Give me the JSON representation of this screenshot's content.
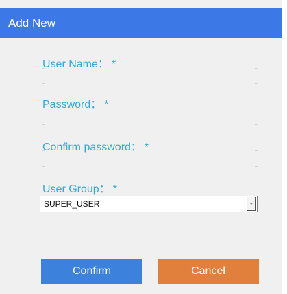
{
  "dialog": {
    "title": "Add New"
  },
  "fields": {
    "user_name": {
      "label": "User Name：",
      "required_mark": "*",
      "value": ""
    },
    "password": {
      "label": "Password：",
      "required_mark": "*",
      "value": ""
    },
    "confirm_password": {
      "label": "Confirm password：",
      "required_mark": "*",
      "value": ""
    },
    "user_group": {
      "label": "User Group：",
      "required_mark": "*",
      "selected": "SUPER_USER"
    }
  },
  "buttons": {
    "confirm_label": "Confirm",
    "cancel_label": "Cancel"
  },
  "colors": {
    "title_bar": "#3c78e6",
    "label_text": "#33a9dc",
    "confirm_button": "#3c82dc",
    "cancel_button": "#e0803c",
    "dialog_background": "#f0f0f0"
  }
}
